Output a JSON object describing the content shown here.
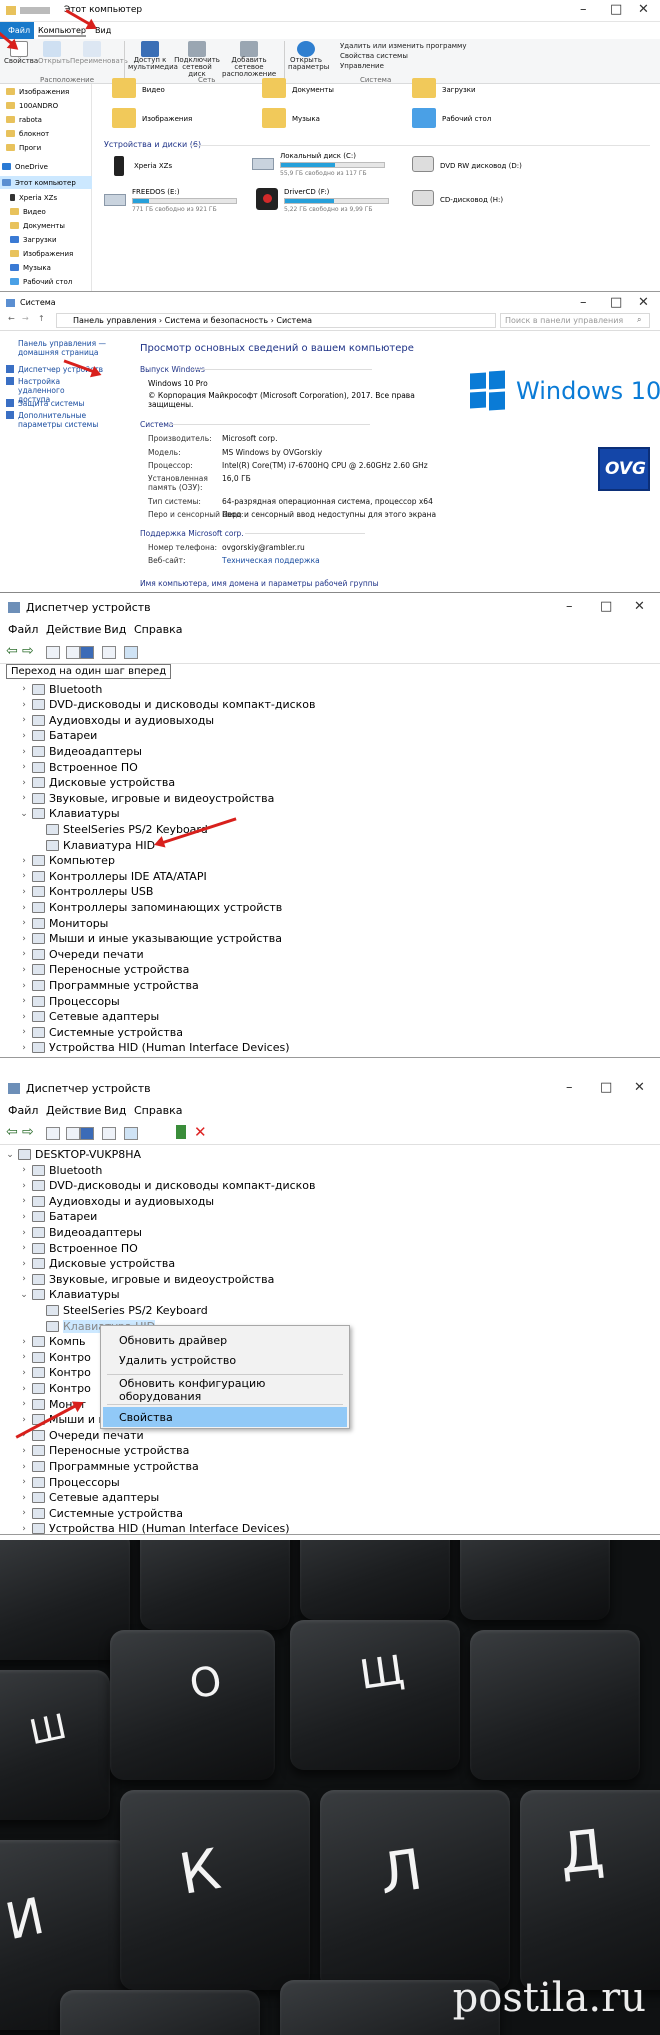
{
  "explorer": {
    "title": "Этот компьютер",
    "tabs": [
      "Файл",
      "Компьютер",
      "Вид"
    ],
    "ribbon_buttons": [
      "Свойства",
      "Открыть",
      "Переименовать",
      "Доступ к мультимедиа",
      "Подключить сетевой диск",
      "Добавить сетевое расположение",
      "Открыть параметры"
    ],
    "ribbon_right": [
      "Удалить или изменить программу",
      "Свойства системы",
      "Управление"
    ],
    "groups": [
      "Расположение",
      "Сеть",
      "Система"
    ],
    "nav": [
      "Изображения",
      "100ANDRO",
      "rabota",
      "блокнот",
      "Проги",
      "OneDrive",
      "Этот компьютер",
      "Xperia XZs",
      "Видео",
      "Документы",
      "Загрузки",
      "Изображения",
      "Музыка",
      "Рабочий стол"
    ],
    "folders_top": [
      "Видео",
      "Документы",
      "Загрузки"
    ],
    "folders": [
      "Изображения",
      "Музыка",
      "Рабочий стол"
    ],
    "devices_header": "Устройства и диски (6)",
    "drives": [
      {
        "name": "Xperia XZs",
        "free": "",
        "pct": 0
      },
      {
        "name": "Локальный диск (C:)",
        "free": "55,9 ГБ свободно из 117 ГБ",
        "pct": 52
      },
      {
        "name": "DVD RW дисковод (D:)",
        "free": "",
        "pct": 0
      },
      {
        "name": "FREEDOS (E:)",
        "free": "771 ГБ свободно из 921 ГБ",
        "pct": 16
      },
      {
        "name": "DriverCD (F:)",
        "free": "5,22 ГБ свободно из 9,99 ГБ",
        "pct": 48
      },
      {
        "name": "CD-дисковод (H:)",
        "free": "",
        "pct": 0
      }
    ]
  },
  "system": {
    "title": "Система",
    "breadcrumb": "Панель управления  ›  Система и безопасность  ›  Система",
    "search_placeholder": "Поиск в панели управления",
    "left_nav": [
      "Панель управления — домашняя страница",
      "Диспетчер устройств",
      "Настройка удаленного доступа",
      "Защита системы",
      "Дополнительные параметры системы"
    ],
    "heading": "Просмотр основных сведений о вашем компьютере",
    "edition_label": "Выпуск Windows",
    "edition": "Windows 10 Pro",
    "copyright": "© Корпорация Майкрософт (Microsoft Corporation), 2017. Все права защищены.",
    "logo_text": "Windows 10",
    "oem_logo": "OVG",
    "system_label": "Система",
    "rows": [
      [
        "Производитель:",
        "Microsoft corp."
      ],
      [
        "Модель:",
        "MS Windows by OVGorskiy"
      ],
      [
        "Процессор:",
        "Intel(R) Core(TM) i7-6700HQ CPU @ 2.60GHz   2.60 GHz"
      ],
      [
        "Установленная память (ОЗУ):",
        "16,0 ГБ"
      ],
      [
        "Тип системы:",
        "64-разрядная операционная система, процессор x64"
      ],
      [
        "Перо и сенсорный ввод:",
        "Перо и сенсорный ввод недоступны для этого экрана"
      ]
    ],
    "support_label": "Поддержка Microsoft corp.",
    "support_rows": [
      [
        "Номер телефона:",
        "ovgorskiy@rambler.ru"
      ],
      [
        "Веб-сайт:",
        "Техническая поддержка"
      ]
    ],
    "footer": "Имя компьютера, имя домена и параметры рабочей группы"
  },
  "devmgr": {
    "title": "Диспетчер устройств",
    "menu": [
      "Файл",
      "Действие",
      "Вид",
      "Справка"
    ],
    "tooltip": "Переход на один шаг вперед",
    "root": "DESKTOP-VUKP8HA",
    "items": [
      "Bluetooth",
      "DVD-дисководы и дисководы компакт-дисков",
      "Аудиовходы и аудиовыходы",
      "Батареи",
      "Видеоадаптеры",
      "Встроенное ПО",
      "Дисковые устройства",
      "Звуковые, игровые и видеоустройства",
      "Клавиатуры",
      "SteelSeries PS/2 Keyboard",
      "Клавиатура HID",
      "Компьютер",
      "Контроллеры IDE ATA/ATAPI",
      "Контроллеры USB",
      "Контроллеры запоминающих устройств",
      "Мониторы",
      "Мыши и иные указывающие устройства",
      "Очереди печати",
      "Переносные устройства",
      "Программные устройства",
      "Процессоры",
      "Сетевые адаптеры",
      "Системные устройства",
      "Устройства HID (Human Interface Devices)"
    ],
    "items4_truncated": [
      "Компь",
      "Контро",
      "Контро",
      "Контро",
      "Монит",
      "Мыши и иные указывающие устройства"
    ],
    "context_menu": [
      "Обновить драйвер",
      "Удалить устройство",
      "Обновить конфигурацию оборудования",
      "Свойства"
    ]
  },
  "photo": {
    "keys": [
      "Ш",
      "О",
      "Щ",
      "К",
      "Л",
      "Д",
      "И"
    ],
    "watermark": "postila.ru"
  }
}
